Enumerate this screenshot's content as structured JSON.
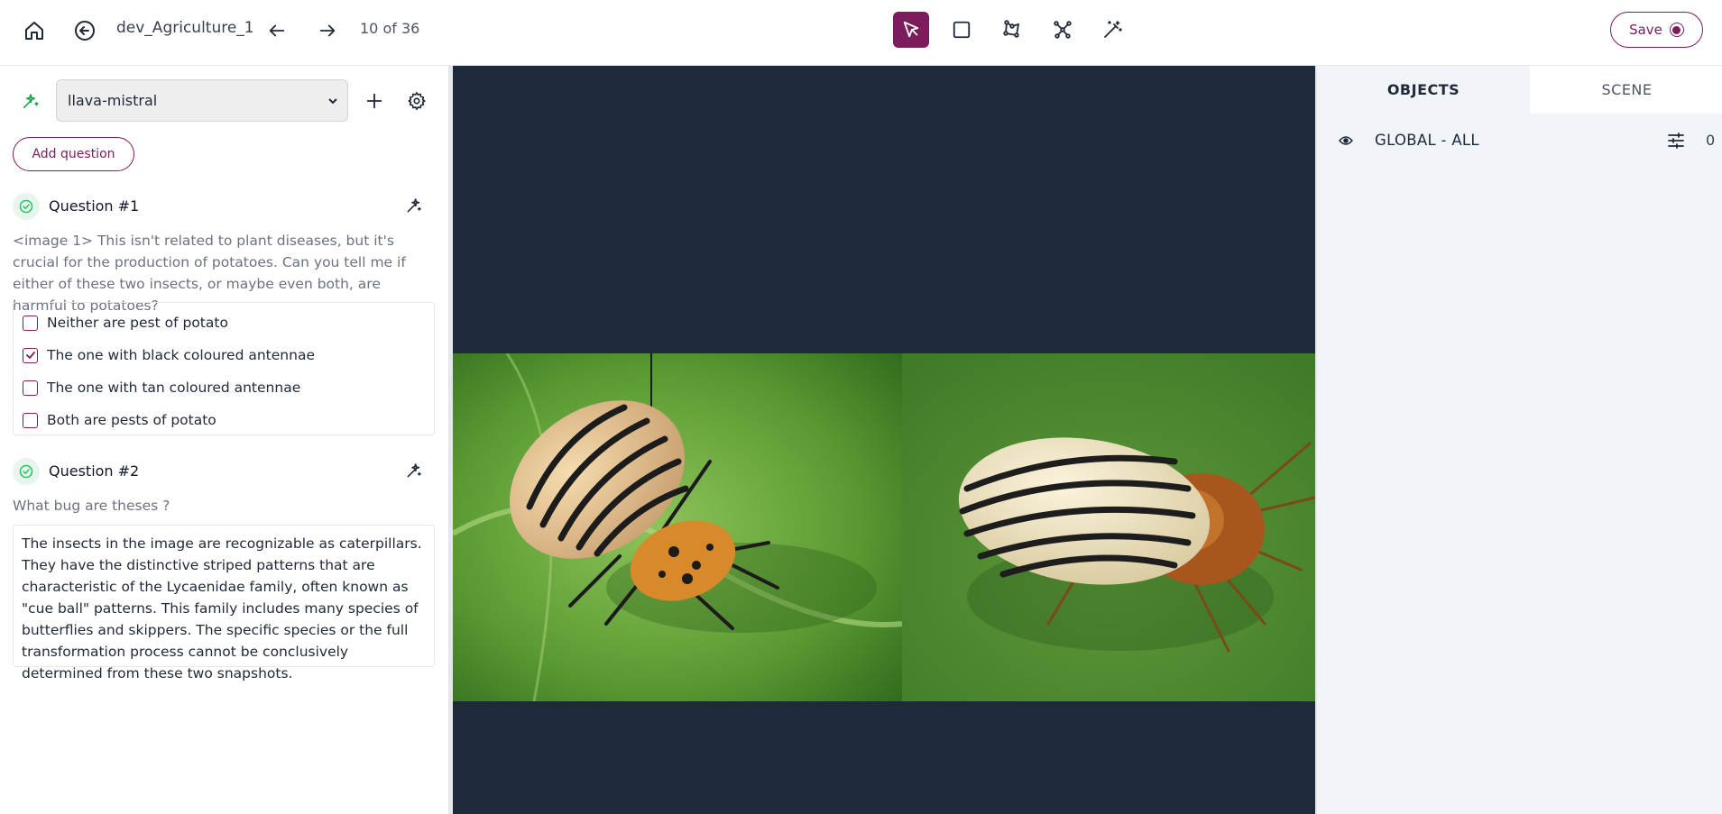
{
  "header": {
    "dataset_name": "dev_Agriculture_1",
    "counter": "10 of 36",
    "save_label": "Save",
    "accent_color": "#7b1c5c"
  },
  "toolbar": {
    "tools": [
      "pointer-tool",
      "rectangle-tool",
      "polygon-tool",
      "keypoint-tool",
      "magic-wand-tool"
    ],
    "active_tool": "pointer-tool"
  },
  "left_panel": {
    "model": "llava-mistral",
    "add_question_label": "Add question",
    "questions": [
      {
        "title": "Question #1",
        "prompt": "<image 1> This isn't related to plant diseases, but it's crucial for the production of potatoes. Can you tell me if either of these two insects, or maybe even both, are harmful to potatoes?",
        "options": [
          {
            "label": "Neither are pest of potato",
            "checked": false
          },
          {
            "label": "The one with black coloured antennae",
            "checked": true
          },
          {
            "label": "The one with tan coloured antennae",
            "checked": false
          },
          {
            "label": "Both are pests of potato",
            "checked": false
          }
        ]
      },
      {
        "title": "Question #2",
        "prompt": "What bug are theses ?",
        "answer": " The insects in the image are recognizable as caterpillars. They have the distinctive striped patterns that are characteristic of the Lycaenidae family, often known as \"cue ball\" patterns. This family includes many species of butterflies and skippers. The specific species or the full transformation process cannot be conclusively determined from these two snapshots."
      }
    ]
  },
  "right_panel": {
    "tabs": [
      "OBJECTS",
      "SCENE"
    ],
    "active_tab": "OBJECTS",
    "objects": [
      {
        "label": "GLOBAL - ALL",
        "count": "0"
      }
    ]
  }
}
